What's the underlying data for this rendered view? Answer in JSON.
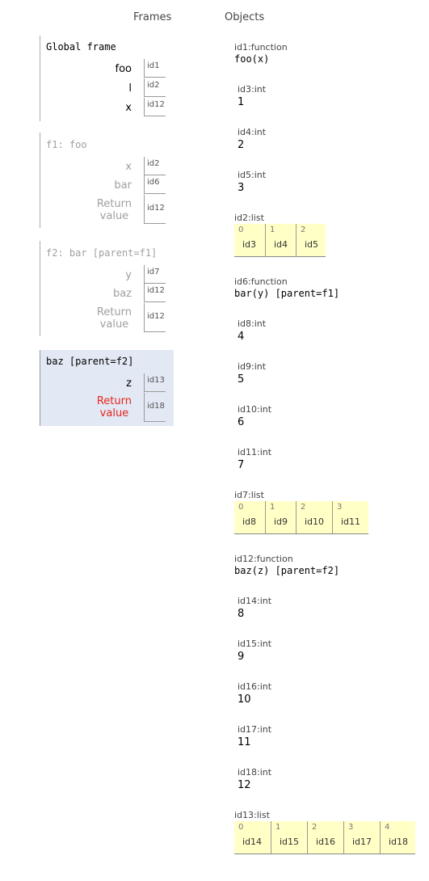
{
  "headers": {
    "frames": "Frames",
    "objects": "Objects"
  },
  "frames": {
    "global": {
      "name": "Global frame",
      "vars": [
        {
          "name": "foo",
          "ref": "id1"
        },
        {
          "name": "l",
          "ref": "id2"
        },
        {
          "name": "x",
          "ref": "id12"
        }
      ]
    },
    "f1": {
      "name": "f1: foo",
      "vars": [
        {
          "name": "x",
          "ref": "id2"
        },
        {
          "name": "bar",
          "ref": "id6"
        }
      ],
      "return_label": "Return\nvalue",
      "return_ref": "id12"
    },
    "f2": {
      "name": "f2: bar [parent=f1]",
      "vars": [
        {
          "name": "y",
          "ref": "id7"
        },
        {
          "name": "baz",
          "ref": "id12"
        }
      ],
      "return_label": "Return\nvalue",
      "return_ref": "id12"
    },
    "baz": {
      "name": "baz [parent=f2]",
      "vars": [
        {
          "name": "z",
          "ref": "id13"
        }
      ],
      "return_label": "Return\nvalue",
      "return_ref": "id18"
    }
  },
  "objects": {
    "id1": {
      "label": "id1:function",
      "value": "foo(x)"
    },
    "id3": {
      "label": "id3:int",
      "value": "1"
    },
    "id4": {
      "label": "id4:int",
      "value": "2"
    },
    "id5": {
      "label": "id5:int",
      "value": "3"
    },
    "id2": {
      "label": "id2:list",
      "items": [
        {
          "idx": "0",
          "ref": "id3"
        },
        {
          "idx": "1",
          "ref": "id4"
        },
        {
          "idx": "2",
          "ref": "id5"
        }
      ]
    },
    "id6": {
      "label": "id6:function",
      "value": "bar(y) [parent=f1]"
    },
    "id8": {
      "label": "id8:int",
      "value": "4"
    },
    "id9": {
      "label": "id9:int",
      "value": "5"
    },
    "id10": {
      "label": "id10:int",
      "value": "6"
    },
    "id11": {
      "label": "id11:int",
      "value": "7"
    },
    "id7": {
      "label": "id7:list",
      "items": [
        {
          "idx": "0",
          "ref": "id8"
        },
        {
          "idx": "1",
          "ref": "id9"
        },
        {
          "idx": "2",
          "ref": "id10"
        },
        {
          "idx": "3",
          "ref": "id11"
        }
      ]
    },
    "id12": {
      "label": "id12:function",
      "value": "baz(z) [parent=f2]"
    },
    "id14": {
      "label": "id14:int",
      "value": "8"
    },
    "id15": {
      "label": "id15:int",
      "value": "9"
    },
    "id16": {
      "label": "id16:int",
      "value": "10"
    },
    "id17": {
      "label": "id17:int",
      "value": "11"
    },
    "id18": {
      "label": "id18:int",
      "value": "12"
    },
    "id13": {
      "label": "id13:list",
      "items": [
        {
          "idx": "0",
          "ref": "id14"
        },
        {
          "idx": "1",
          "ref": "id15"
        },
        {
          "idx": "2",
          "ref": "id16"
        },
        {
          "idx": "3",
          "ref": "id17"
        },
        {
          "idx": "4",
          "ref": "id18"
        }
      ]
    }
  }
}
